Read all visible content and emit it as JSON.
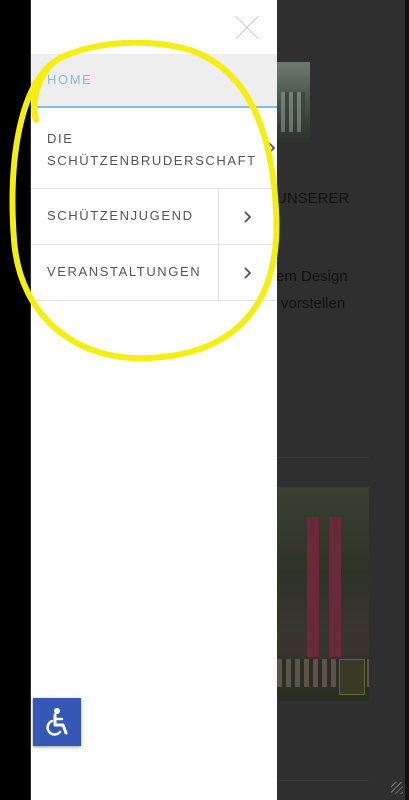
{
  "background_page": {
    "text_1": "UNSERER",
    "text_2": "em Design",
    "text_3": "vorstellen"
  },
  "drawer": {
    "close_icon": "close-icon",
    "items": [
      {
        "label": "HOME",
        "active": true
      },
      {
        "label": "DIE SCHÜTZENBRUDERSCHAFT",
        "has_submenu": true
      },
      {
        "label": "SCHÜTZENJUGEND",
        "has_submenu": true
      },
      {
        "label": "VERANSTALTUNGEN",
        "has_submenu": true
      }
    ],
    "chevron_icon": "chevron-right-icon"
  },
  "accessibility_button": {
    "icon": "wheelchair-icon"
  },
  "colors": {
    "active_text": "#84bcd2",
    "active_underline": "#84c1d8",
    "accessibility_bg": "#3557b5",
    "highlight_annotation": "#f5ee12"
  }
}
